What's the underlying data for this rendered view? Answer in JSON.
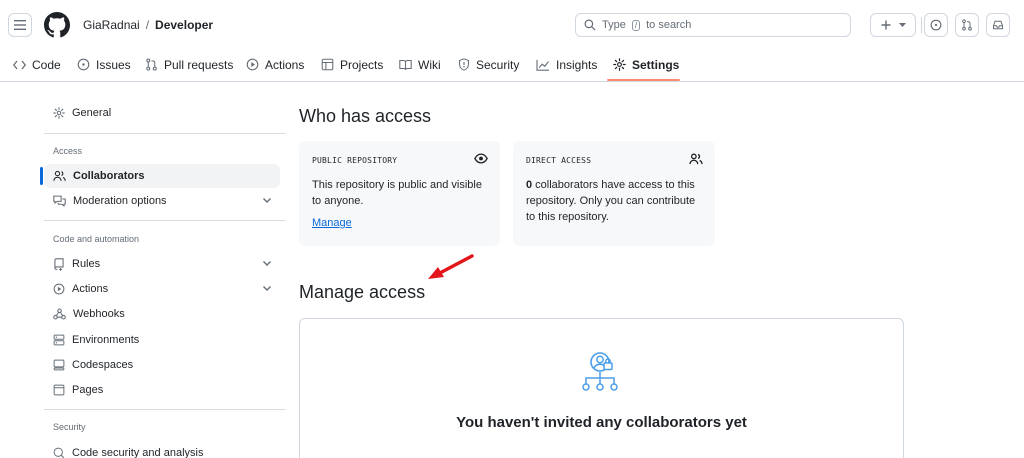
{
  "header": {
    "owner": "GiaRadnai",
    "separator": "/",
    "repo": "Developer",
    "search_prefix": "Type",
    "search_key": "/",
    "search_suffix": "to search"
  },
  "nav": {
    "code": "Code",
    "issues": "Issues",
    "pulls": "Pull requests",
    "actions": "Actions",
    "projects": "Projects",
    "wiki": "Wiki",
    "security": "Security",
    "insights": "Insights",
    "settings": "Settings"
  },
  "sidebar": {
    "general": "General",
    "access_heading": "Access",
    "collaborators": "Collaborators",
    "moderation": "Moderation options",
    "code_automation_heading": "Code and automation",
    "rules": "Rules",
    "actions": "Actions",
    "webhooks": "Webhooks",
    "environments": "Environments",
    "codespaces": "Codespaces",
    "pages": "Pages",
    "security_heading": "Security",
    "code_security": "Code security and analysis"
  },
  "main": {
    "who_title": "Who has access",
    "public_card": {
      "caption": "PUBLIC REPOSITORY",
      "line1": "This repository is public and visible",
      "line2": "to anyone.",
      "link": "Manage"
    },
    "direct_card": {
      "caption": "DIRECT ACCESS",
      "count": "0",
      "line1_rest": " collaborators have access to this",
      "line2": "repository. Only you can contribute",
      "line3": "to this repository."
    },
    "manage_title": "Manage access",
    "empty_title": "You haven't invited any collaborators yet"
  },
  "colors": {
    "accent_blue": "#0969da",
    "settings_underline": "#fd8c73",
    "annotation_arrow": "#e3171b",
    "empty_icon": "#4a9ee8"
  }
}
